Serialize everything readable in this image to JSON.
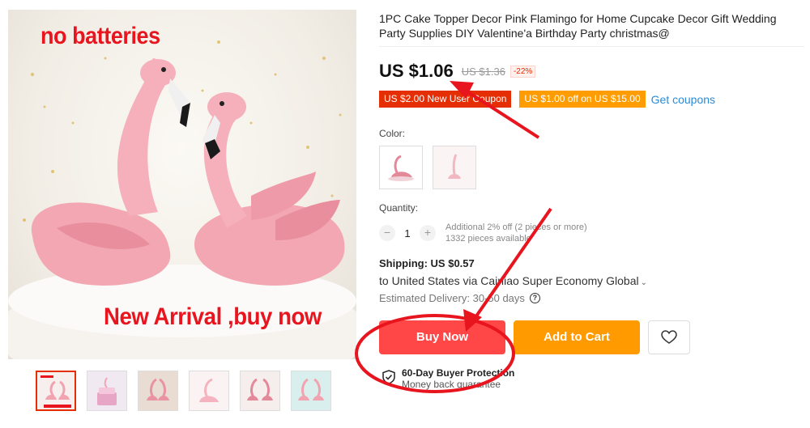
{
  "gallery": {
    "overlay_top": "no batteries",
    "overlay_bottom": "New Arrival ,buy now",
    "thumbnail_count": 6
  },
  "product": {
    "title": "1PC Cake Topper Decor Pink Flamingo for Home Cupcake Decor Gift Wedding Party Supplies DIY Valentine'a Birthday Party christmas@",
    "price": "US $1.06",
    "original_price": "US $1.36",
    "discount": "-22%",
    "coupons": [
      "US $2.00 New User Coupon",
      "US $1.00 off on US $15.00"
    ],
    "get_coupons": "Get coupons",
    "color_label": "Color:",
    "quantity_label": "Quantity:",
    "quantity_value": "1",
    "qty_minus": "−",
    "qty_plus": "+",
    "qty_note_1": "Additional 2% off (2 pieces or more)",
    "qty_note_2": "1332 pieces available",
    "shipping": "Shipping: US $0.57",
    "ship_route": "to United States via Cainiao Super Economy Global",
    "delivery": "Estimated Delivery: 30-50 days",
    "buy_now": "Buy Now",
    "add_to_cart": "Add to Cart",
    "protection_title": "60-Day Buyer Protection",
    "protection_sub": "Money back guarantee"
  },
  "colors": {
    "accent_red": "#ff4747",
    "accent_orange": "#ff9a00",
    "link_blue": "#2a8bd8",
    "annotation_red": "#e8141e"
  }
}
